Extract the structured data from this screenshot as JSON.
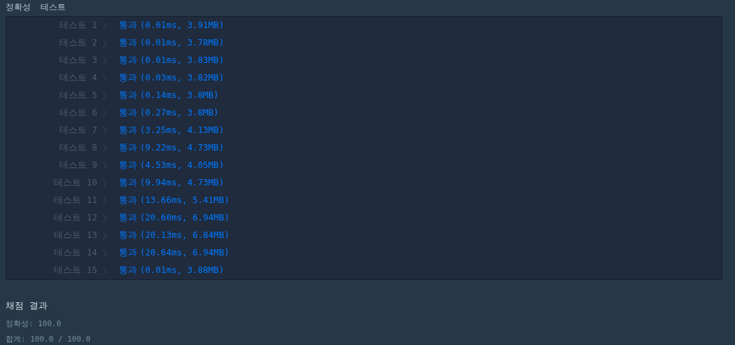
{
  "header": {
    "title": "정확성  테스트"
  },
  "tests": [
    {
      "label": "테스트 1",
      "result": "통과",
      "detail": "(0.01ms, 3.91MB)"
    },
    {
      "label": "테스트 2",
      "result": "통과",
      "detail": "(0.01ms, 3.78MB)"
    },
    {
      "label": "테스트 3",
      "result": "통과",
      "detail": "(0.01ms, 3.83MB)"
    },
    {
      "label": "테스트 4",
      "result": "통과",
      "detail": "(0.03ms, 3.82MB)"
    },
    {
      "label": "테스트 5",
      "result": "통과",
      "detail": "(0.14ms, 3.8MB)"
    },
    {
      "label": "테스트 6",
      "result": "통과",
      "detail": "(0.27ms, 3.8MB)"
    },
    {
      "label": "테스트 7",
      "result": "통과",
      "detail": "(3.25ms, 4.13MB)"
    },
    {
      "label": "테스트 8",
      "result": "통과",
      "detail": "(9.22ms, 4.73MB)"
    },
    {
      "label": "테스트 9",
      "result": "통과",
      "detail": "(4.53ms, 4.05MB)"
    },
    {
      "label": "테스트 10",
      "result": "통과",
      "detail": "(9.94ms, 4.73MB)"
    },
    {
      "label": "테스트 11",
      "result": "통과",
      "detail": "(13.66ms, 5.41MB)"
    },
    {
      "label": "테스트 12",
      "result": "통과",
      "detail": "(20.60ms, 6.94MB)"
    },
    {
      "label": "테스트 13",
      "result": "통과",
      "detail": "(20.13ms, 6.84MB)"
    },
    {
      "label": "테스트 14",
      "result": "통과",
      "detail": "(20.64ms, 6.94MB)"
    },
    {
      "label": "테스트 15",
      "result": "통과",
      "detail": "(0.01ms, 3.88MB)"
    }
  ],
  "summary": {
    "title": "채점 결과",
    "accuracy": "정확성: 100.0",
    "total": "합계: 100.0 / 100.0"
  }
}
